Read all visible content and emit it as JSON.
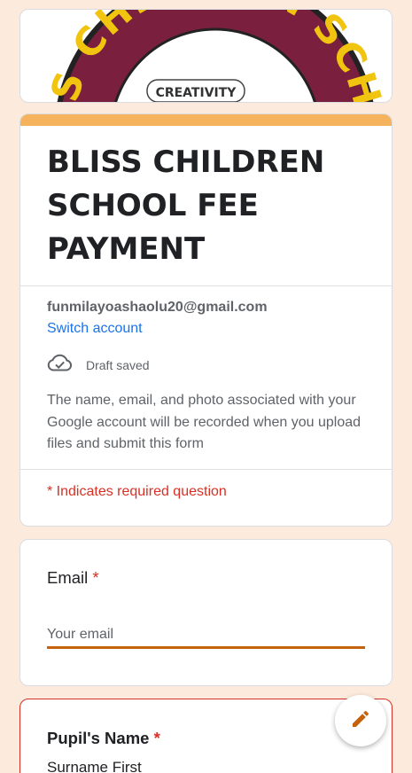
{
  "banner": {
    "arc_text": "BLISS CHILDREN SCHOOL",
    "motto": "CREATIVITY"
  },
  "form": {
    "title": "BLISS CHILDREN SCHOOL FEE PAYMENT",
    "account_email": "funmilayoashaolu20@gmail.com",
    "switch_account": "Switch account",
    "draft_status": "Draft saved",
    "notice": "The name, email, and photo associated with your Google account will be recorded when you upload files and submit this form",
    "required_note": "* Indicates required question"
  },
  "questions": {
    "email": {
      "label": "Email",
      "required_mark": "*",
      "placeholder": "Your email"
    },
    "pupil_name": {
      "label": "Pupil's Name",
      "required_mark": "*",
      "description": "Surname First"
    }
  },
  "colors": {
    "background": "#fcebdc",
    "accent": "#f5b35d",
    "input_underline": "#c4620d",
    "required_red": "#d93025",
    "link_blue": "#1a73e8",
    "logo_maroon": "#7a1f3d"
  },
  "icons": {
    "draft": "cloud-check-icon",
    "fab": "pencil-icon"
  }
}
